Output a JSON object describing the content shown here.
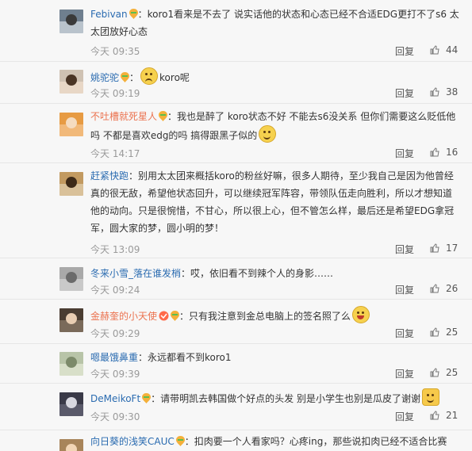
{
  "comments": [
    {
      "user": "Febivan",
      "text": "：koro1看来是不去了 说实话他的状态和心态已经不合适EDG更打不了s6 太太团放好心态",
      "time": "今天 09:35",
      "reply": "回复",
      "likes": "44"
    },
    {
      "user": "姚驼驼",
      "text": "koro呢",
      "time": "今天 09:19",
      "reply": "回复",
      "likes": "38"
    },
    {
      "user": "不吐槽就死星人",
      "text": "：我也是醉了 koro状态不好 不能去s6没关系 但你们需要这么贬低他吗 不都是喜欢edg的吗 搞得跟黑子似的",
      "time": "今天 14:17",
      "reply": "回复",
      "likes": "16"
    },
    {
      "user": "赶紧快跑",
      "text": "：别用太太团来概括koro的粉丝好嘛，很多人期待，至少我自己是因为他曾经真的很无敌，希望他状态回升，可以继续冠军阵容，带领队伍走向胜利，所以才想知道他的动向。只是很惋惜，不甘心，所以很上心，但不管怎么样，最后还是希望EDG拿冠军，圆大家的梦，圆小明的梦！",
      "time": "今天 13:09",
      "reply": "回复",
      "likes": "17"
    },
    {
      "user": "冬来小雪_落在谁发梢",
      "text": "：哎，依旧看不到辣个人的身影……",
      "time": "今天 09:24",
      "reply": "回复",
      "likes": "26"
    },
    {
      "user": "金赫奎的小天使",
      "text": "：只有我注意到金总电脑上的签名照了么",
      "time": "今天 09:29",
      "reply": "回复",
      "likes": "25"
    },
    {
      "user": "嗯最饿鼻重",
      "text": "：永远都看不到koro1",
      "time": "今天 09:39",
      "reply": "回复",
      "likes": "25"
    },
    {
      "user": "DeMeikoFt",
      "text": "：请带明凯去韩国做个好点的头发  别是小学生也别是瓜皮了谢谢",
      "time": "今天 09:30",
      "reply": "回复",
      "likes": "21"
    },
    {
      "user": "向日葵的浅笑CAUC",
      "text": "：扣肉要一个人看家吗？心疼ing，那些说扣肉已经不适合比赛",
      "time": "",
      "reply": "",
      "likes": ""
    }
  ],
  "colors": {
    "username": "#eb7350",
    "username_alt": "#2a6bb0",
    "meta": "#9a9a9a"
  }
}
